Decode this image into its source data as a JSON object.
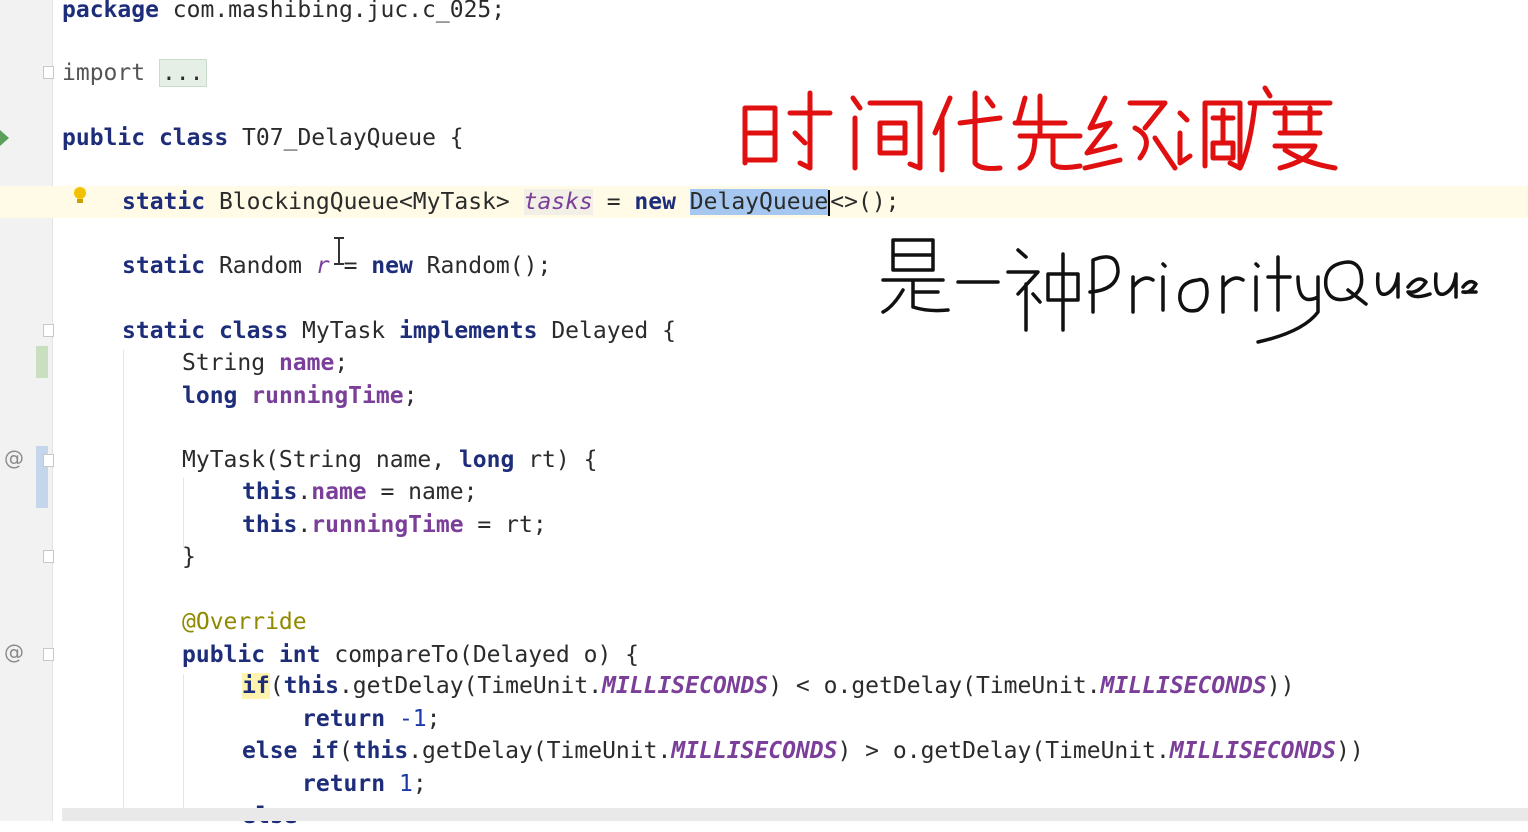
{
  "code_lines": {
    "l1": {
      "kw": "package",
      "rest": " com.mashibing.juc.c_025;"
    },
    "l2": {
      "kw": "import",
      "dots": "..."
    },
    "l3": {
      "kw1": "public",
      "kw2": "class",
      "rest": " T07_DelayQueue {"
    },
    "l4": {
      "kw1": "static",
      "t1": " BlockingQueue<MyTask> ",
      "var": "tasks",
      "t2": " = ",
      "kw2": "new",
      "sp": " ",
      "sel": "DelayQueue",
      "t3": "<>();"
    },
    "l5": {
      "kw1": "static",
      "t1": " Random ",
      "var": "r",
      "t2": " = ",
      "kw2": "new",
      "t3": " Random();"
    },
    "l6": {
      "kw1": "static",
      "kw2": "class",
      "t1": " MyTask ",
      "kw3": "implements",
      "t2": " Delayed {"
    },
    "l7": {
      "t1": "String ",
      "field": "name",
      "t2": ";"
    },
    "l8": {
      "kw": "long",
      "field": "runningTime",
      "t2": ";"
    },
    "l9": {
      "t1": "MyTask(String name, ",
      "kw": "long",
      "t2": " rt) {"
    },
    "l10": {
      "kw": "this",
      "dot": ".",
      "field": "name",
      "t2": " = name;"
    },
    "l11": {
      "kw": "this",
      "dot": ".",
      "field": "runningTime",
      "t2": " = rt;"
    },
    "l12": {
      "t1": "}"
    },
    "l13": {
      "anno": "@Override"
    },
    "l14": {
      "kw1": "public",
      "kw2": "int",
      "t1": " compareTo(Delayed o) {"
    },
    "l15": {
      "kw1": "if",
      "t1": "(",
      "kw2": "this",
      "t2": ".getDelay(TimeUnit.",
      "c1": "MILLISECONDS",
      "t3": ") < o.getDelay(TimeUnit.",
      "c2": "MILLISECONDS",
      "t4": "))"
    },
    "l16": {
      "kw": "return",
      "t1": " ",
      "num": "-1",
      "t2": ";"
    },
    "l17": {
      "kw1": "else",
      "kw2": "if",
      "t1": "(",
      "kw3": "this",
      "t2": ".getDelay(TimeUnit.",
      "c1": "MILLISECONDS",
      "t3": ") > o.getDelay(TimeUnit.",
      "c2": "MILLISECONDS",
      "t4": "))"
    },
    "l18": {
      "kw": "return",
      "t1": " ",
      "num": "1",
      "t2": ";"
    },
    "l19": {
      "kw": "else"
    }
  },
  "gutter": {
    "override_marker": "@"
  },
  "annotations": {
    "handwritten_red": "时间优先级 调度",
    "handwritten_black": "是一种PriorityQueue",
    "red_color": "#e01010",
    "black_color": "#111111"
  },
  "icons": [
    "lightbulb-icon",
    "text-cursor-icon",
    "run-arrow-icon",
    "fold-icon"
  ]
}
